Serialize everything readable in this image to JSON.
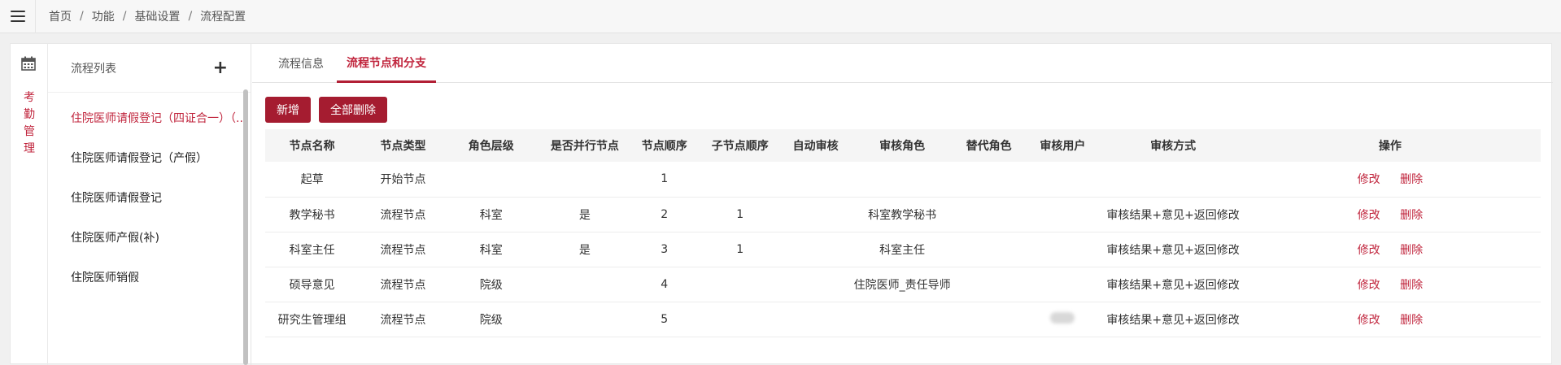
{
  "breadcrumb": [
    "首页",
    "功能",
    "基础设置",
    "流程配置"
  ],
  "sidebar": {
    "module_label": "考勤管理",
    "icon": "calendar-icon"
  },
  "flow_list": {
    "title": "流程列表",
    "add_symbol": "+",
    "items": [
      {
        "label": "住院医师请假登记（四证合一）（..."
      },
      {
        "label": "住院医师请假登记（产假）"
      },
      {
        "label": "住院医师请假登记"
      },
      {
        "label": "住院医师产假(补)"
      },
      {
        "label": "住院医师销假"
      }
    ]
  },
  "tabs": [
    {
      "label": "流程信息"
    },
    {
      "label": "流程节点和分支"
    }
  ],
  "toolbar": {
    "add_label": "新增",
    "delete_all_label": "全部删除"
  },
  "table": {
    "columns": [
      "节点名称",
      "节点类型",
      "角色层级",
      "是否并行节点",
      "节点顺序",
      "子节点顺序",
      "自动审核",
      "审核角色",
      "替代角色",
      "审核用户",
      "审核方式",
      "操作"
    ],
    "edit_label": "修改",
    "delete_label": "删除",
    "rows": [
      {
        "name": "起草",
        "type": "开始节点",
        "level": "",
        "parallel": "",
        "order": "1",
        "sub_order": "",
        "auto": "",
        "role": "",
        "alt_role": "",
        "user": "",
        "method": ""
      },
      {
        "name": "教学秘书",
        "type": "流程节点",
        "level": "科室",
        "parallel": "是",
        "order": "2",
        "sub_order": "1",
        "auto": "",
        "role": "科室教学秘书",
        "alt_role": "",
        "user": "",
        "method": "审核结果+意见+返回修改"
      },
      {
        "name": "科室主任",
        "type": "流程节点",
        "level": "科室",
        "parallel": "是",
        "order": "3",
        "sub_order": "1",
        "auto": "",
        "role": "科室主任",
        "alt_role": "",
        "user": "",
        "method": "审核结果+意见+返回修改"
      },
      {
        "name": "硕导意见",
        "type": "流程节点",
        "level": "院级",
        "parallel": "",
        "order": "4",
        "sub_order": "",
        "auto": "",
        "role": "住院医师_责任导师",
        "alt_role": "",
        "user": "",
        "method": "审核结果+意见+返回修改"
      },
      {
        "name": "研究生管理组",
        "type": "流程节点",
        "level": "院级",
        "parallel": "",
        "order": "5",
        "sub_order": "",
        "auto": "",
        "role": "",
        "alt_role": "",
        "user": "",
        "method": "审核结果+意见+返回修改"
      }
    ]
  }
}
